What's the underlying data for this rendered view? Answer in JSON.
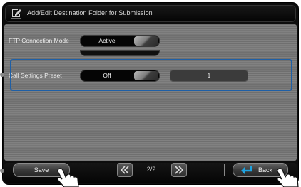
{
  "window": {
    "title": "Add/Edit Destination Folder for Submission",
    "title_icon": "edit-folder-icon"
  },
  "settings": {
    "ftp_connection_mode": {
      "label": "FTP Connection Mode",
      "value": "Active"
    },
    "call_settings_preset": {
      "label": "Call Settings Preset",
      "value": "Off",
      "number": "1"
    }
  },
  "footer": {
    "save_label": "Save",
    "page_indicator": "2/2",
    "back_label": "Back",
    "prev_icon": "double-chevron-left-icon",
    "next_icon": "double-chevron-right-icon",
    "back_icon": "return-arrow-icon"
  },
  "colors": {
    "highlight": "#1e5fa6",
    "back_arrow": "#1fa3e0",
    "background": "#0d0d0d"
  }
}
